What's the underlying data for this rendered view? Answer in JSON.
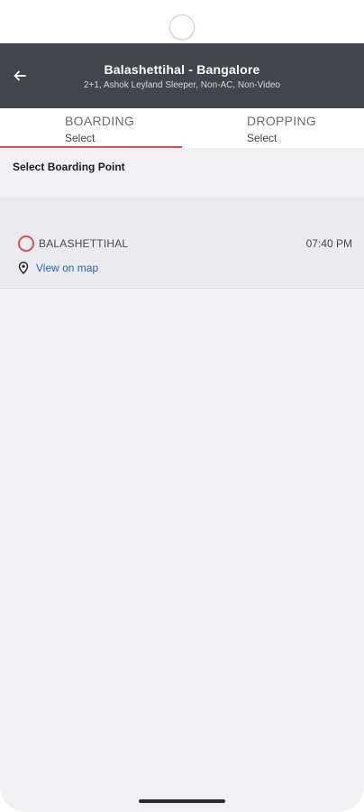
{
  "header": {
    "title": "Balashettihal - Bangalore",
    "subtitle": "2+1, Ashok Leyland Sleeper, Non-AC, Non-Video"
  },
  "tabs": [
    {
      "label": "BOARDING",
      "sub": "Select",
      "active": true
    },
    {
      "label": "DROPPING",
      "sub": "Select",
      "active": false
    }
  ],
  "section": {
    "title": "Select Boarding Point"
  },
  "points": [
    {
      "name": "BALASHETTIHAL",
      "time": "07:40 PM",
      "map_label": "View on map"
    }
  ],
  "colors": {
    "header_bg": "#40474b",
    "accent": "#d84e55",
    "link": "#2463c4",
    "background": "#f1f1f3"
  },
  "icons": {
    "back": "arrow-left-icon",
    "map": "location-pin-icon",
    "radio": "radio-unselected-icon"
  }
}
